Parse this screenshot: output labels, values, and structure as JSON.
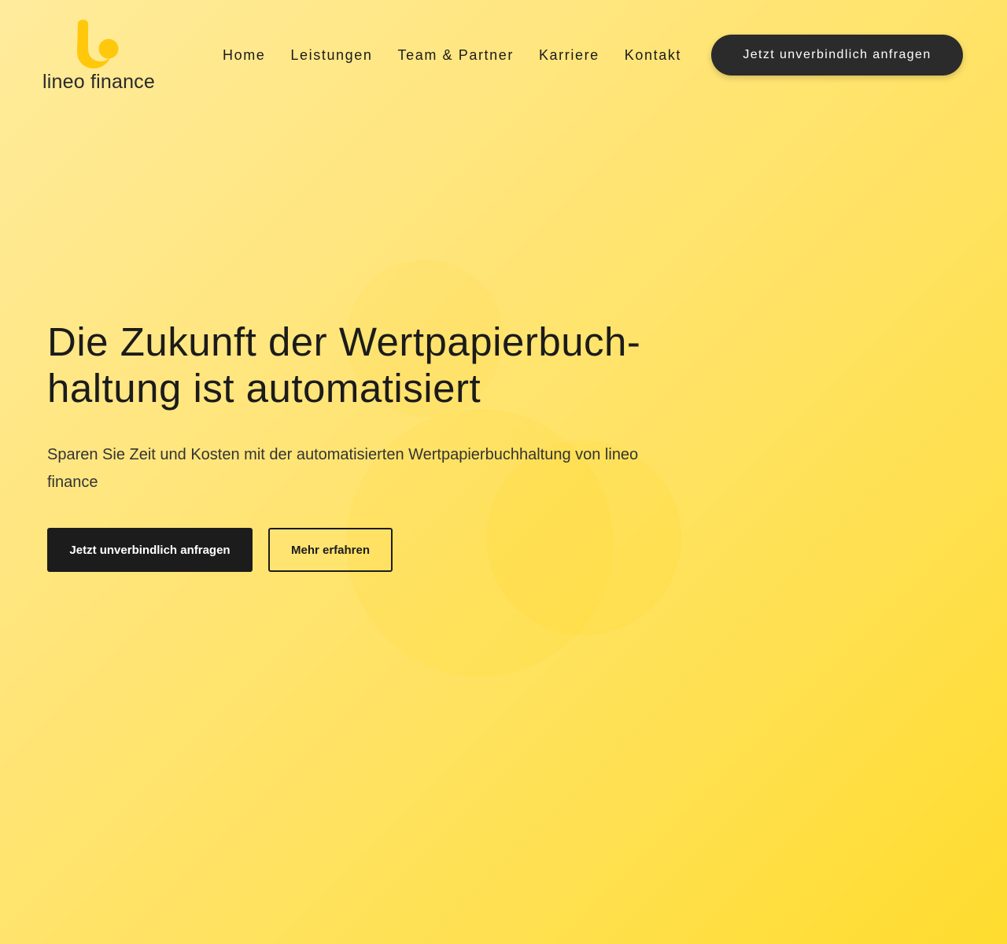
{
  "brand": {
    "name": "lineo finance",
    "logo_icon": "lineo-l-logo-icon",
    "accent_color": "#ffc80a"
  },
  "nav": {
    "items": [
      {
        "label": "Home"
      },
      {
        "label": "Leistungen"
      },
      {
        "label": "Team & Partner"
      },
      {
        "label": "Karriere"
      },
      {
        "label": "Kontakt"
      }
    ],
    "cta_label": "Jetzt unverbindlich anfragen"
  },
  "hero": {
    "title_line1": "Die Zukunft der Wertpapierbuch-",
    "title_line2": "haltung ist automatisiert",
    "subtitle": "Sparen Sie Zeit und Kosten mit der automatisierten Wertpapierbuchhaltung von lineo finance",
    "primary_button": "Jetzt unverbindlich anfragen",
    "secondary_button": "Mehr erfahren"
  },
  "colors": {
    "background_start": "#ffeb9c",
    "background_end": "#ffdc2e",
    "dark": "#1c1c1c",
    "cta_dark": "#2b2b2b"
  }
}
